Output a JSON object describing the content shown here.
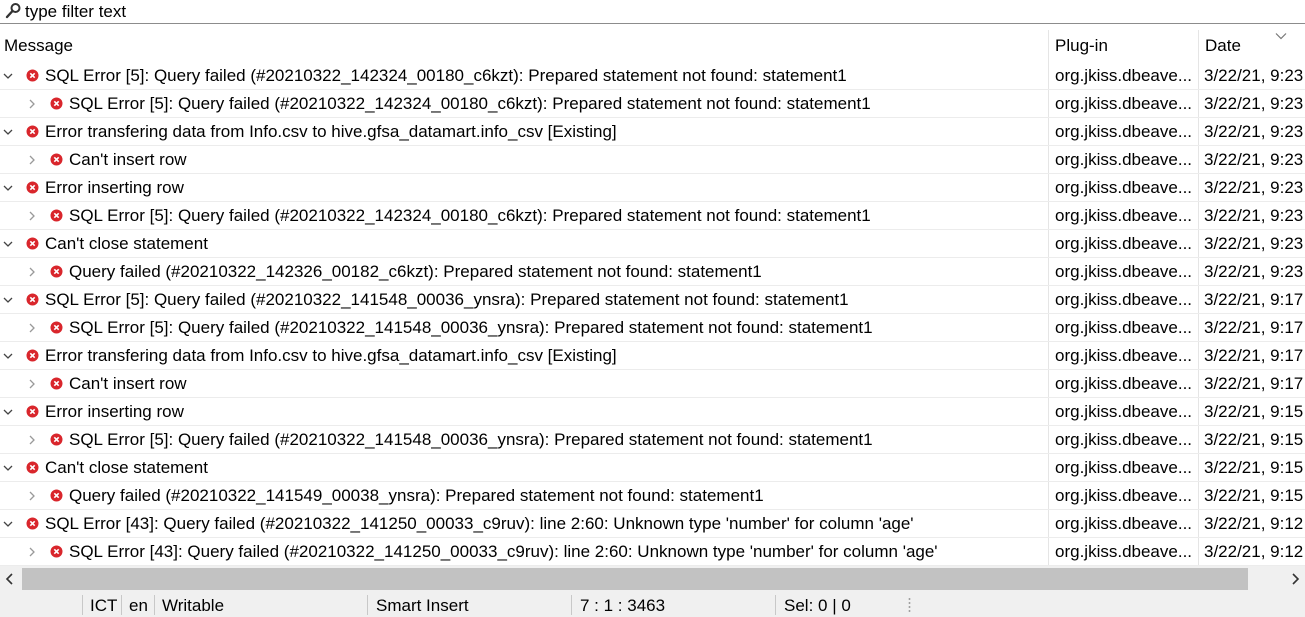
{
  "filter": {
    "placeholder": "type filter text"
  },
  "columns": {
    "message": "Message",
    "plugin": "Plug-in",
    "date": "Date"
  },
  "rows": [
    {
      "level": "parent",
      "message": "SQL Error [5]: Query failed (#20210322_142324_00180_c6kzt): Prepared statement not found: statement1",
      "plugin": "org.jkiss.dbeave...",
      "date": "3/22/21, 9:23"
    },
    {
      "level": "child",
      "message": "SQL Error [5]: Query failed (#20210322_142324_00180_c6kzt): Prepared statement not found: statement1",
      "plugin": "org.jkiss.dbeave...",
      "date": "3/22/21, 9:23"
    },
    {
      "level": "parent",
      "message": "Error transfering data from Info.csv to hive.gfsa_datamart.info_csv [Existing]",
      "plugin": "org.jkiss.dbeave...",
      "date": "3/22/21, 9:23"
    },
    {
      "level": "child",
      "message": "Can't insert row",
      "plugin": "org.jkiss.dbeave...",
      "date": "3/22/21, 9:23"
    },
    {
      "level": "parent",
      "message": "Error inserting row",
      "plugin": "org.jkiss.dbeave...",
      "date": "3/22/21, 9:23"
    },
    {
      "level": "child",
      "message": "SQL Error [5]: Query failed (#20210322_142324_00180_c6kzt): Prepared statement not found: statement1",
      "plugin": "org.jkiss.dbeave...",
      "date": "3/22/21, 9:23"
    },
    {
      "level": "parent",
      "message": "Can't close statement",
      "plugin": "org.jkiss.dbeave...",
      "date": "3/22/21, 9:23"
    },
    {
      "level": "child",
      "message": "Query failed (#20210322_142326_00182_c6kzt): Prepared statement not found: statement1",
      "plugin": "org.jkiss.dbeave...",
      "date": "3/22/21, 9:23"
    },
    {
      "level": "parent",
      "message": "SQL Error [5]: Query failed (#20210322_141548_00036_ynsra): Prepared statement not found: statement1",
      "plugin": "org.jkiss.dbeave...",
      "date": "3/22/21, 9:17"
    },
    {
      "level": "child",
      "message": "SQL Error [5]: Query failed (#20210322_141548_00036_ynsra): Prepared statement not found: statement1",
      "plugin": "org.jkiss.dbeave...",
      "date": "3/22/21, 9:17"
    },
    {
      "level": "parent",
      "message": "Error transfering data from Info.csv to hive.gfsa_datamart.info_csv [Existing]",
      "plugin": "org.jkiss.dbeave...",
      "date": "3/22/21, 9:17"
    },
    {
      "level": "child",
      "message": "Can't insert row",
      "plugin": "org.jkiss.dbeave...",
      "date": "3/22/21, 9:17"
    },
    {
      "level": "parent",
      "message": "Error inserting row",
      "plugin": "org.jkiss.dbeave...",
      "date": "3/22/21, 9:15"
    },
    {
      "level": "child",
      "message": "SQL Error [5]: Query failed (#20210322_141548_00036_ynsra): Prepared statement not found: statement1",
      "plugin": "org.jkiss.dbeave...",
      "date": "3/22/21, 9:15"
    },
    {
      "level": "parent",
      "message": "Can't close statement",
      "plugin": "org.jkiss.dbeave...",
      "date": "3/22/21, 9:15"
    },
    {
      "level": "child",
      "message": "Query failed (#20210322_141549_00038_ynsra): Prepared statement not found: statement1",
      "plugin": "org.jkiss.dbeave...",
      "date": "3/22/21, 9:15"
    },
    {
      "level": "parent",
      "message": "SQL Error [43]: Query failed (#20210322_141250_00033_c9ruv): line 2:60: Unknown type 'number' for column 'age'",
      "plugin": "org.jkiss.dbeave...",
      "date": "3/22/21, 9:12"
    },
    {
      "level": "child",
      "message": "SQL Error [43]: Query failed (#20210322_141250_00033_c9ruv): line 2:60: Unknown type 'number' for column 'age'",
      "plugin": "org.jkiss.dbeave...",
      "date": "3/22/21, 9:12"
    }
  ],
  "status_bar": {
    "timezone": "ICT",
    "language": "en",
    "mode": "Writable",
    "insert_mode": "Smart Insert",
    "position": "7 : 1 : 3463",
    "selection": "Sel: 0 | 0"
  },
  "colors": {
    "error": "#d9262c",
    "scrollbar_thumb": "#c2c2c2",
    "chrome": "#f0f0f0"
  }
}
